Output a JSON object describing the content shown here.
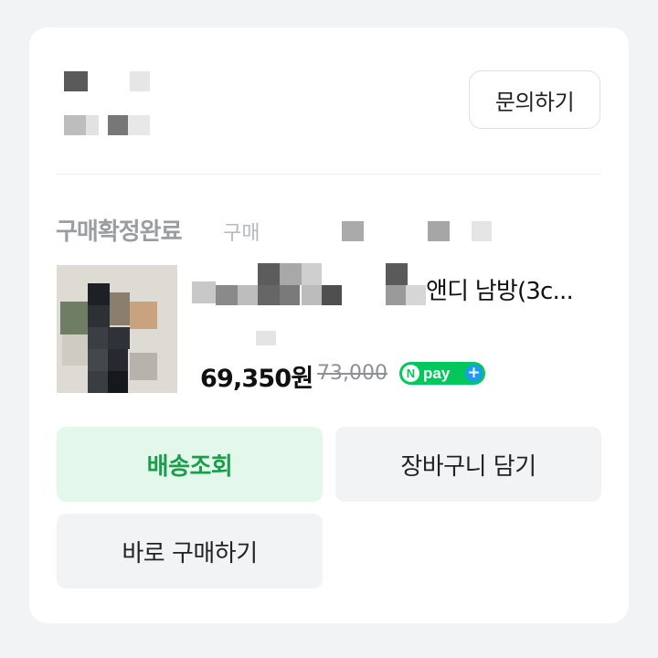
{
  "header": {
    "inquiry_button_label": "문의하기"
  },
  "order": {
    "status": "구매확정완료",
    "status_sub": "구매"
  },
  "product": {
    "name_visible": "앤디 남방(3c...",
    "price": "69,350원",
    "original_price": "73,000",
    "npay_label": "pay",
    "npay_n": "N",
    "npay_plus": "+"
  },
  "actions": {
    "track_label": "배송조회",
    "cart_label": "장바구니 담기",
    "buy_now_label": "바로 구매하기"
  },
  "colors": {
    "accent_green": "#1a9e4b",
    "track_bg": "#e3f8eb",
    "npay_green": "#03c75a",
    "npay_plus_blue": "#1e9bf0"
  }
}
